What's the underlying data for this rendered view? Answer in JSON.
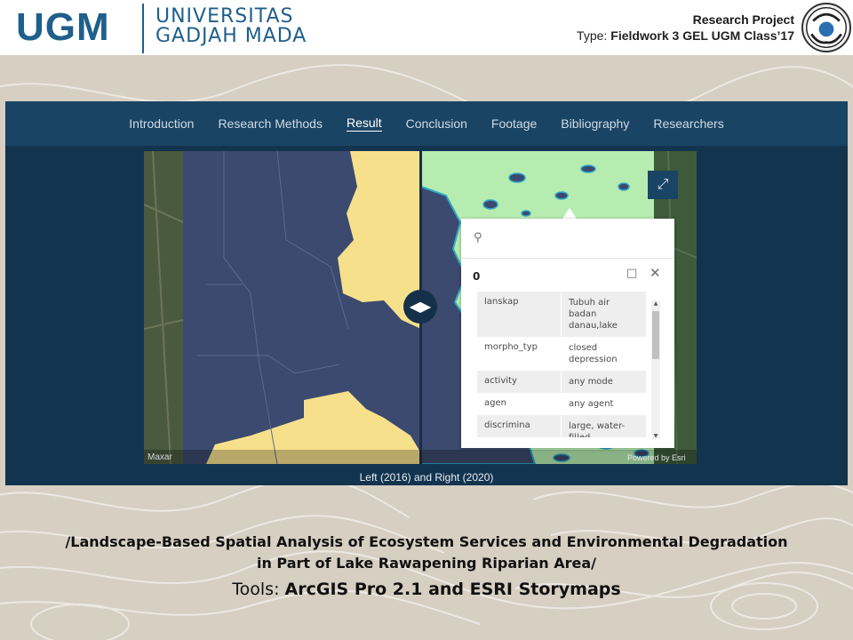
{
  "header": {
    "logo_mark": "UGM",
    "university_line1": "UNIVERSITAS",
    "university_line2": "GADJAH MADA",
    "project_label": "Research Project",
    "type_label": "Type:",
    "type_value": "Fieldwork 3 GEL UGM Class’17"
  },
  "nav": {
    "items": [
      {
        "label": "Introduction"
      },
      {
        "label": "Research Methods"
      },
      {
        "label": "Result"
      },
      {
        "label": "Conclusion"
      },
      {
        "label": "Footage"
      },
      {
        "label": "Bibliography"
      },
      {
        "label": "Researchers"
      }
    ],
    "active_item": "Result"
  },
  "map": {
    "caption": "Left (2016) and Right (2020)",
    "credit_left": "Maxar",
    "credit_right": "Powered by Esri",
    "colors": {
      "lake_dark": "#3b4a6e",
      "yellow_land": "#f6e08c",
      "green_land": "#b6ecb0",
      "water_cyan": "#2fa8c8"
    }
  },
  "popup": {
    "title": "0",
    "rows": [
      {
        "key": "lanskap",
        "value": "Tubuh air badan danau,lake"
      },
      {
        "key": "morpho_typ",
        "value": "closed depression"
      },
      {
        "key": "activity",
        "value": "any mode"
      },
      {
        "key": "agen",
        "value": "any agent"
      },
      {
        "key": "discrimina",
        "value": "large, water-filled"
      }
    ]
  },
  "footer": {
    "title_line1": "/Landscape-Based Spatial Analysis of Ecosystem Services and Environmental Degradation",
    "title_line2": "in Part of Lake Rawapening Riparian Area/",
    "tools_label": "Tools: ",
    "tools_value": "ArcGIS Pro 2.1 and ESRI Storymaps"
  }
}
